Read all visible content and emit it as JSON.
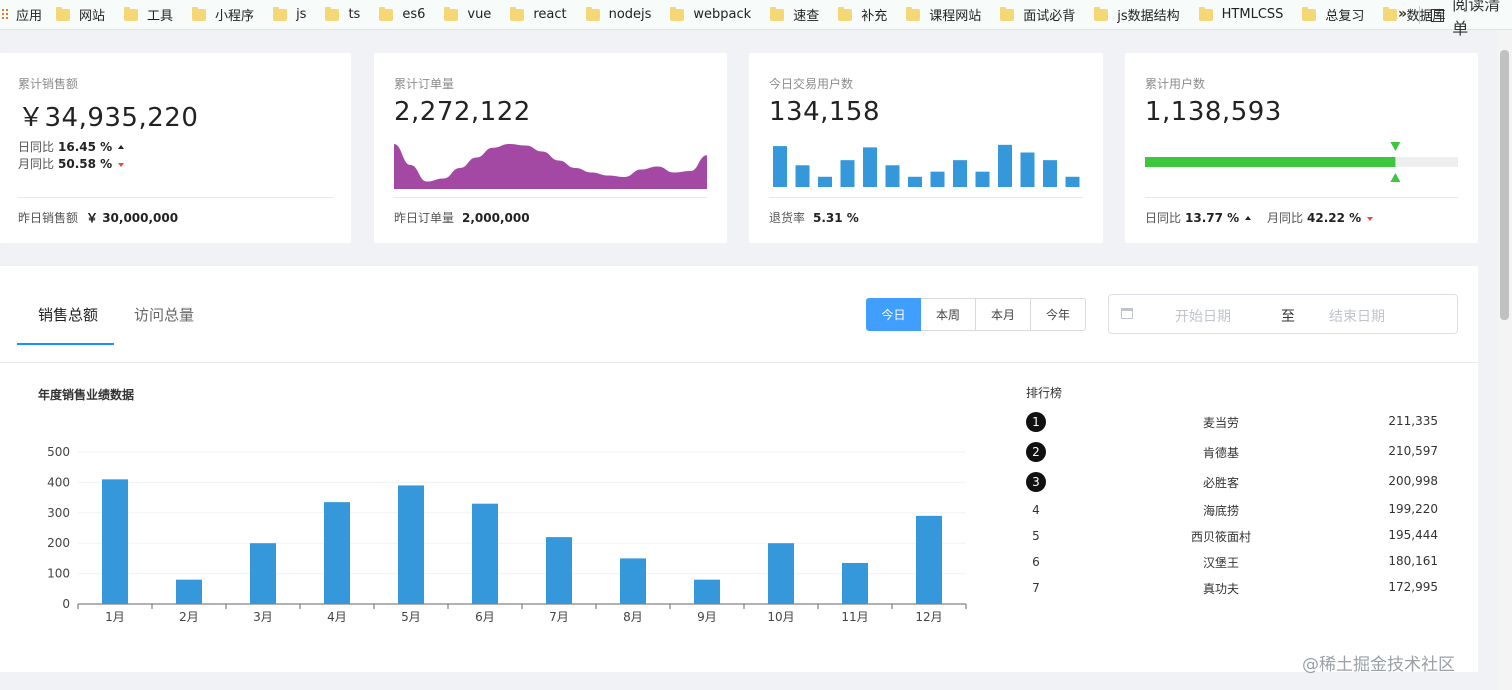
{
  "bookmarks": {
    "apps_label": "应用",
    "folders": [
      "网站",
      "工具",
      "小程序",
      "js",
      "ts",
      "es6",
      "vue",
      "react",
      "nodejs",
      "webpack",
      "速查",
      "补充",
      "课程网站",
      "面试必背",
      "js数据结构",
      "HTMLCSS",
      "总复习",
      "数据库"
    ],
    "more": "»",
    "reading_list": "阅读清单"
  },
  "cards": {
    "sales": {
      "title": "累计销售额",
      "value": "￥34,935,220",
      "day_label": "日同比",
      "day_value": "16.45 %",
      "month_label": "月同比",
      "month_value": "50.58 %",
      "foot_label": "昨日销售额",
      "foot_value": "￥ 30,000,000"
    },
    "orders": {
      "title": "累计订单量",
      "value": "2,272,122",
      "foot_label": "昨日订单量",
      "foot_value": "2,000,000",
      "area_color": "#a349a4",
      "area_values": [
        60,
        32,
        10,
        14,
        28,
        42,
        55,
        60,
        58,
        50,
        38,
        28,
        22,
        18,
        16,
        26,
        30,
        22,
        24,
        45
      ]
    },
    "users_today": {
      "title": "今日交易用户数",
      "value": "134,158",
      "foot_label": "退货率",
      "foot_value": "5.31 %",
      "bar_color": "#3498db",
      "bar_values": [
        32,
        17,
        8,
        21,
        31,
        17,
        8,
        12,
        21,
        12,
        33,
        27,
        21,
        8
      ]
    },
    "total_users": {
      "title": "累计用户数",
      "value": "1,138,593",
      "progress_fraction": 0.8,
      "progress_color": "#3ec73e",
      "day_label": "日同比",
      "day_value": "13.77 %",
      "month_label": "月同比",
      "month_value": "42.22 %"
    }
  },
  "panel": {
    "tabs": [
      "销售总额",
      "访问总量"
    ],
    "range_buttons": [
      "今日",
      "本周",
      "本月",
      "今年"
    ],
    "date_start_placeholder": "开始日期",
    "date_sep": "至",
    "date_end_placeholder": "结束日期",
    "chart_title": "年度销售业绩数据",
    "ranking_title": "排行榜",
    "ranking": [
      {
        "rank": "1",
        "name": "麦当劳",
        "value": "211,335"
      },
      {
        "rank": "2",
        "name": "肯德基",
        "value": "210,597"
      },
      {
        "rank": "3",
        "name": "必胜客",
        "value": "200,998"
      },
      {
        "rank": "4",
        "name": "海底捞",
        "value": "199,220"
      },
      {
        "rank": "5",
        "name": "西贝筱面村",
        "value": "195,444"
      },
      {
        "rank": "6",
        "name": "汉堡王",
        "value": "180,161"
      },
      {
        "rank": "7",
        "name": "真功夫",
        "value": "172,995"
      }
    ]
  },
  "chart_data": {
    "type": "bar",
    "categories": [
      "1月",
      "2月",
      "3月",
      "4月",
      "5月",
      "6月",
      "7月",
      "8月",
      "9月",
      "10月",
      "11月",
      "12月"
    ],
    "values": [
      410,
      80,
      200,
      335,
      390,
      330,
      220,
      150,
      80,
      200,
      135,
      290
    ],
    "title": "年度销售业绩数据",
    "xlabel": "",
    "ylabel": "",
    "ylim": [
      0,
      500
    ],
    "yticks": [
      "0",
      "100",
      "200",
      "300",
      "400",
      "500"
    ],
    "grid": true,
    "color": "#3498db"
  },
  "watermark": "@稀土掘金技术社区"
}
